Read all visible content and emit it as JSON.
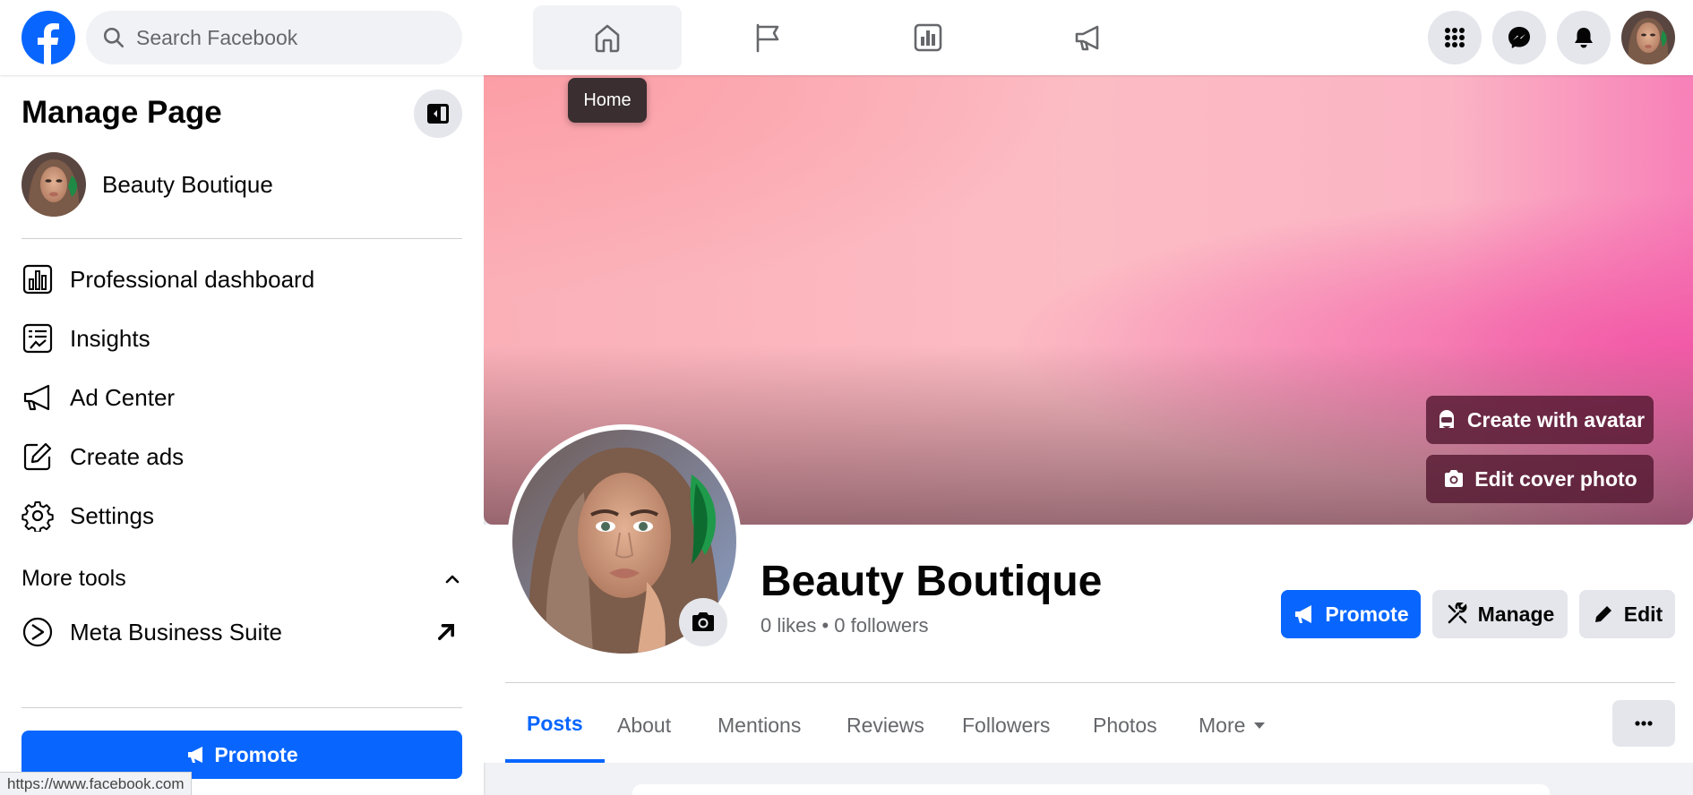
{
  "topbar": {
    "search_placeholder": "Search Facebook",
    "tooltip": "Home",
    "nav_tabs": [
      {
        "name": "home",
        "icon": "home-icon",
        "active": true
      },
      {
        "name": "pages",
        "icon": "flag-icon",
        "active": false
      },
      {
        "name": "insights",
        "icon": "bar-chart-icon",
        "active": false
      },
      {
        "name": "ads",
        "icon": "megaphone-icon",
        "active": false
      }
    ],
    "right_icons": [
      "menu-grid-icon",
      "messenger-icon",
      "notifications-bell-icon",
      "profile-avatar"
    ]
  },
  "sidebar": {
    "title": "Manage Page",
    "page_name": "Beauty Boutique",
    "items": [
      {
        "label": "Professional dashboard",
        "icon": "dashboard-icon"
      },
      {
        "label": "Insights",
        "icon": "insights-icon"
      },
      {
        "label": "Ad Center",
        "icon": "megaphone-icon"
      },
      {
        "label": "Create ads",
        "icon": "edit-square-icon"
      },
      {
        "label": "Settings",
        "icon": "gear-icon"
      }
    ],
    "more_tools_label": "More tools",
    "tools": [
      {
        "label": "Meta Business Suite",
        "icon": "meta-business-suite-icon"
      }
    ],
    "promote_label": "Promote"
  },
  "status_url": "https://www.facebook.com",
  "cover": {
    "create_avatar_label": "Create with avatar",
    "edit_cover_label": "Edit cover photo"
  },
  "profile": {
    "name": "Beauty Boutique",
    "stats": "0 likes • 0 followers",
    "promote_label": "Promote",
    "manage_label": "Manage",
    "edit_label": "Edit"
  },
  "tabs": [
    {
      "label": "Posts",
      "active": true
    },
    {
      "label": "About",
      "active": false
    },
    {
      "label": "Mentions",
      "active": false
    },
    {
      "label": "Reviews",
      "active": false
    },
    {
      "label": "Followers",
      "active": false
    },
    {
      "label": "Photos",
      "active": false
    },
    {
      "label": "More",
      "active": false
    }
  ],
  "colors": {
    "brand_blue": "#0866ff",
    "text_secondary": "#65676b",
    "background": "#f0f2f5"
  }
}
